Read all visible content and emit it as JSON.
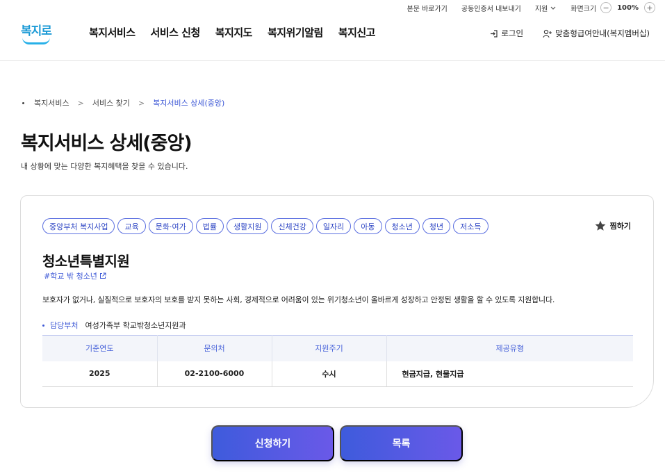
{
  "utility": {
    "skip_link": "본문 바로가기",
    "cert_export": "공동인증서 내보내기",
    "support": "지원",
    "zoom_label": "화면크기",
    "zoom_value": "100%",
    "zoom_minus": "−",
    "zoom_plus": "+"
  },
  "header": {
    "logo_text": "복지로",
    "nav": [
      "복지서비스",
      "서비스 신청",
      "복지지도",
      "복지위기알림",
      "복지신고"
    ],
    "login": "로그인",
    "membership": "맞춤형급여안내(복지멤버십)"
  },
  "breadcrumb": {
    "items": [
      "복지서비스",
      "서비스 찾기"
    ],
    "current": "복지서비스 상세(중앙)"
  },
  "page": {
    "title": "복지서비스 상세(중앙)",
    "description": "내 상황에 맞는 다양한 복지혜택을 찾을 수 있습니다."
  },
  "service": {
    "tags": [
      "중앙부처 복지사업",
      "교육",
      "문화·여가",
      "법률",
      "생활지원",
      "신체건강",
      "일자리",
      "아동",
      "청소년",
      "청년",
      "저소득"
    ],
    "favorite_label": "찜하기",
    "title": "청소년특별지원",
    "hashtag": "#학교 밖 청소년",
    "description": "보호자가 없거나, 실질적으로 보호자의 보호를 받지 못하는 사회, 경제적으로 어려움이 있는 위기청소년이 올바르게 성장하고 안정된 생활을 할 수 있도록 지원합니다.",
    "dept_label": "담당부처",
    "dept_value": "여성가족부 학교밖청소년지원과",
    "table": {
      "headers": [
        "기준연도",
        "문의처",
        "지원주기",
        "제공유형"
      ],
      "row": [
        "2025",
        "02-2100-6000",
        "수시",
        "현금지급, 현물지급"
      ]
    }
  },
  "actions": {
    "apply": "신청하기",
    "list": "목록"
  },
  "colors": {
    "accent": "#3d58d6",
    "button_gradient_start": "#3e5bdc",
    "button_gradient_end": "#6a59e8",
    "logo": "#1b9ad6"
  },
  "icons": {
    "login": "login-icon",
    "member": "user-plus-icon",
    "favorite": "star-icon",
    "external": "external-link-icon",
    "support_dropdown": "chevron-down-icon"
  }
}
